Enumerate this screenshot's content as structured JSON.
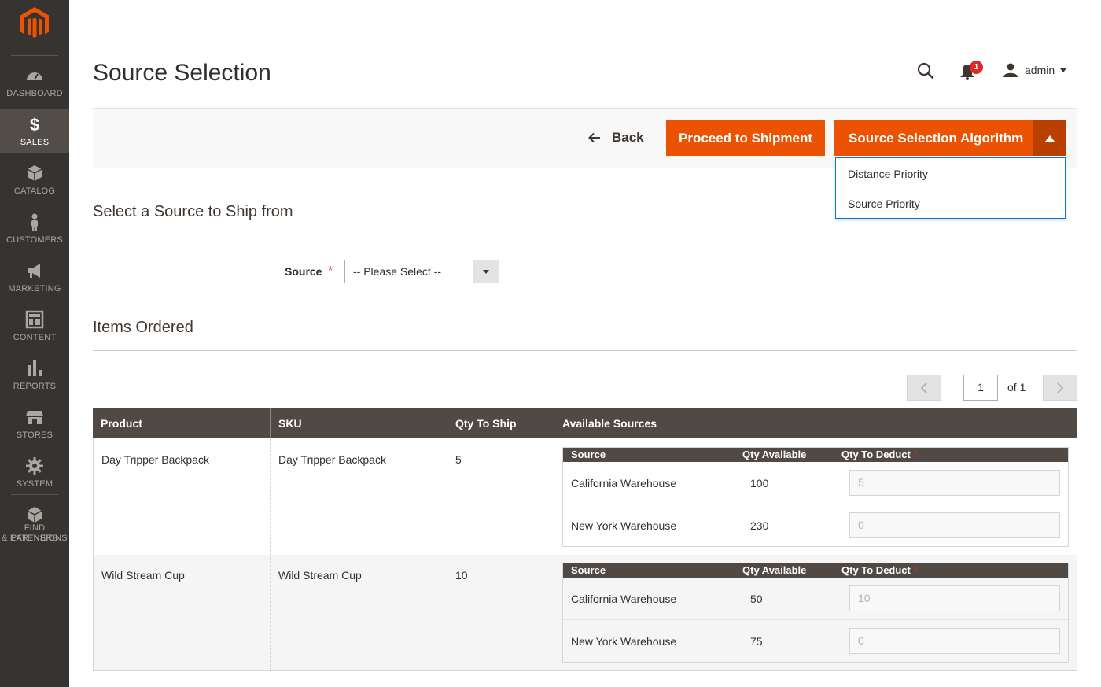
{
  "sidebar": {
    "items": [
      {
        "label": "DASHBOARD",
        "icon": "speedometer-icon"
      },
      {
        "label": "SALES",
        "icon": "dollar-icon",
        "active": true
      },
      {
        "label": "CATALOG",
        "icon": "box-icon"
      },
      {
        "label": "CUSTOMERS",
        "icon": "person-icon"
      },
      {
        "label": "MARKETING",
        "icon": "megaphone-icon"
      },
      {
        "label": "CONTENT",
        "icon": "layout-icon"
      },
      {
        "label": "REPORTS",
        "icon": "bar-chart-icon"
      },
      {
        "label": "STORES",
        "icon": "storefront-icon"
      },
      {
        "label": "SYSTEM",
        "icon": "gear-icon"
      },
      {
        "label_line1": "FIND PARTNERS",
        "label_line2": "& EXTENSIONS",
        "icon": "puzzle-box-icon"
      }
    ]
  },
  "header": {
    "title": "Source Selection",
    "notification_count": "1",
    "user": "admin"
  },
  "actions": {
    "back": "Back",
    "proceed": "Proceed to Shipment",
    "algorithm": "Source Selection Algorithm",
    "algorithm_options": [
      "Distance Priority",
      "Source Priority"
    ]
  },
  "source_section": {
    "title": "Select a Source to Ship from",
    "label": "Source",
    "required_mark": "*",
    "selected": "-- Please Select --"
  },
  "items_section": {
    "title": "Items Ordered",
    "pager": {
      "current": "1",
      "of": "of 1"
    },
    "columns": [
      "Product",
      "SKU",
      "Qty To Ship",
      "Available Sources"
    ],
    "sub_columns": [
      "Source",
      "Qty Available",
      "Qty To Deduct"
    ],
    "rows": [
      {
        "product": "Day Tripper Backpack",
        "sku": "Day Tripper Backpack",
        "qty": "5",
        "sources": [
          {
            "name": "California Warehouse",
            "available": "100",
            "deduct": "5"
          },
          {
            "name": "New York Warehouse",
            "available": "230",
            "deduct": "0"
          }
        ]
      },
      {
        "product": "Wild Stream Cup",
        "sku": "Wild Stream Cup",
        "qty": "10",
        "sources": [
          {
            "name": "California Warehouse",
            "available": "50",
            "deduct": "10"
          },
          {
            "name": "New York Warehouse",
            "available": "75",
            "deduct": "0"
          }
        ]
      }
    ]
  },
  "colors": {
    "sidebar": "#373330",
    "accent": "#eb5202",
    "accent_dark": "#ba4000",
    "table_header": "#514943"
  }
}
